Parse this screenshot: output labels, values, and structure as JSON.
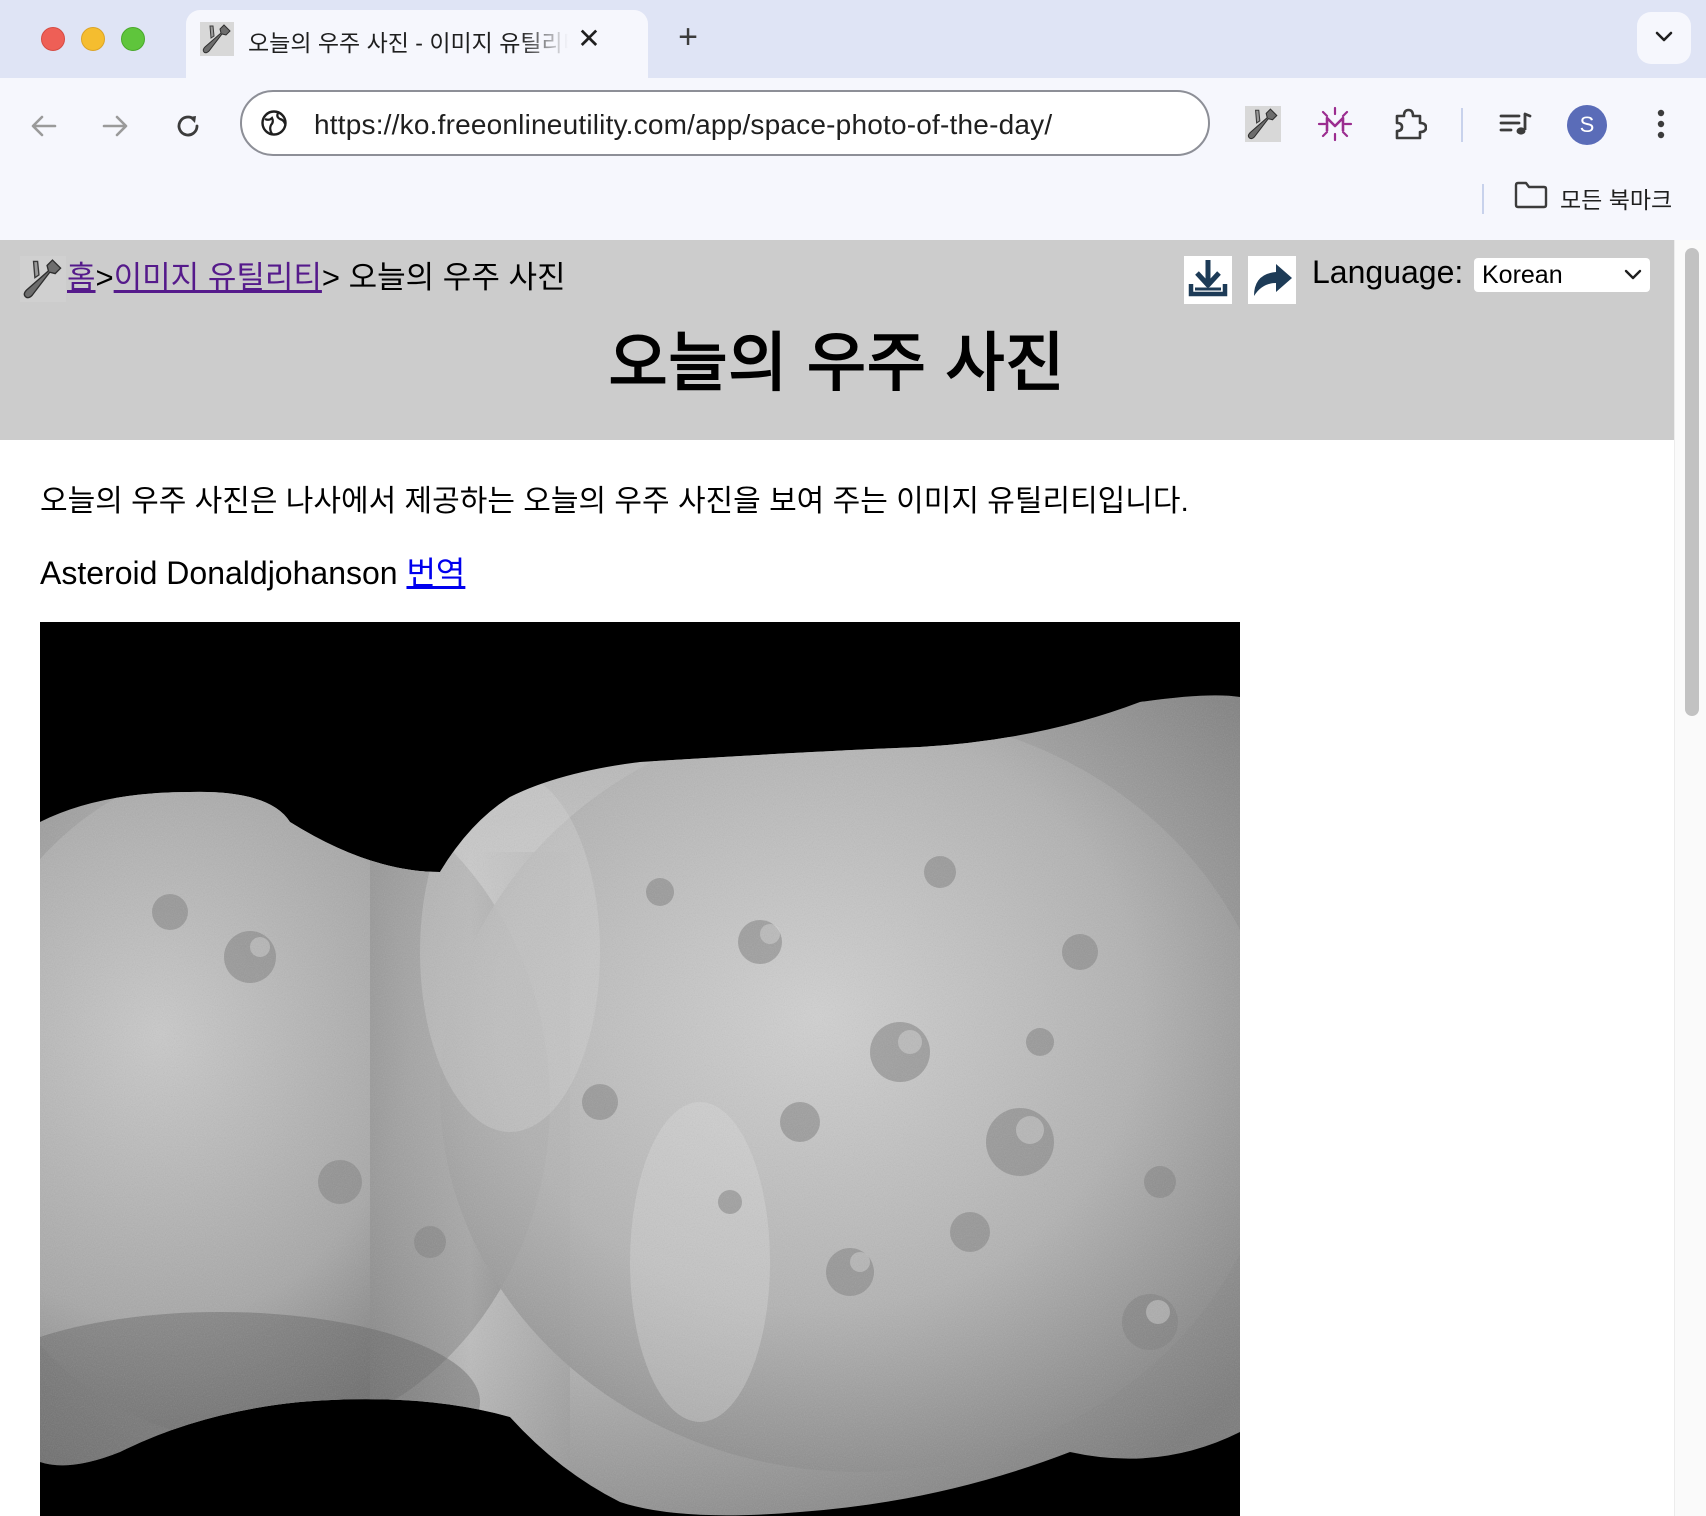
{
  "browser": {
    "tab": {
      "title": "오늘의 우주 사진 - 이미지 유틸리티",
      "close_glyph": "✕"
    },
    "new_tab_glyph": "+",
    "address": {
      "url": "https://ko.freeonlineutility.com/app/space-photo-of-the-day/"
    },
    "profile_initial": "S",
    "bookmarks": {
      "all_bookmarks_label": "모든 북마크"
    }
  },
  "page": {
    "breadcrumb": {
      "home_label": "홈",
      "separator_1": ">",
      "category_label": "이미지 유틸리티",
      "separator_2": "> ",
      "current_label": "오늘의 우주 사진"
    },
    "language_label": "Language:",
    "language_selected": "Korean",
    "title": "오늘의 우주 사진",
    "description": "오늘의 우주 사진은 나사에서 제공하는 오늘의 우주 사진을 보여 주는 이미지 유틸리티입니다.",
    "photo_title": "Asteroid Donaldjohanson",
    "translate_link": "번역"
  },
  "colors": {
    "tabbar_bg": "#dfe4f5",
    "toolbar_bg": "#f6f7fd",
    "header_band": "#cccccc",
    "visited_link": "#551a8b",
    "link": "#0000ee",
    "avatar": "#5a6cb8",
    "extension_accent": "#9b2c8f"
  },
  "icons": {
    "tab_favicon": "wrench-screwdriver-icon",
    "back": "arrow-left-icon",
    "forward": "arrow-right-icon",
    "reload": "reload-icon",
    "site_info": "globe-icon",
    "extensions": [
      "wrench-screwdriver-icon",
      "sparkle-m-icon",
      "puzzle-icon",
      "media-queue-icon"
    ],
    "menu": "kebab-menu-icon",
    "bookmarks_folder": "folder-icon",
    "download": "download-icon",
    "share": "share-arrow-icon"
  }
}
